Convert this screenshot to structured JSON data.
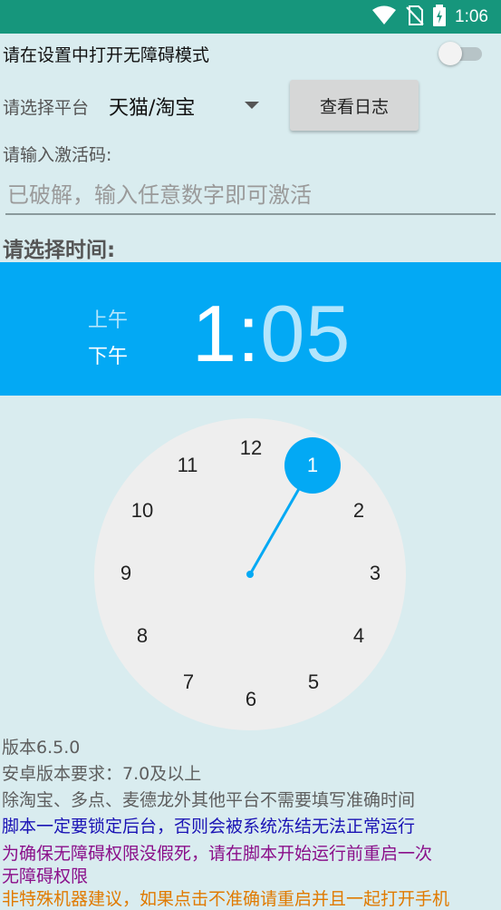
{
  "status_bar": {
    "time": "1:06"
  },
  "accessibility": {
    "label": "请在设置中打开无障碍模式",
    "enabled": false
  },
  "platform": {
    "label": "请选择平台",
    "selected": "天猫/淘宝"
  },
  "log_button": {
    "label": "查看日志"
  },
  "activation": {
    "label": "请输入激活码:",
    "placeholder": "已破解，输入任意数字即可激活"
  },
  "time_picker": {
    "title": "请选择时间:",
    "am_label": "上午",
    "pm_label": "下午",
    "hour": "1",
    "separator": ":",
    "minute": "05",
    "numbers": [
      "12",
      "1",
      "2",
      "3",
      "4",
      "5",
      "6",
      "7",
      "8",
      "9",
      "10",
      "11"
    ],
    "selected_hour": "1",
    "accent_color": "#03a9f4"
  },
  "info": {
    "version": "版本6.5.0",
    "android_req": "安卓版本要求：7.0及以上",
    "note1": "除淘宝、多点、麦德龙外其他平台不需要填写准确时间",
    "note2": "脚本一定要锁定后台，否则会被系统冻结无法正常运行",
    "note3_line1": "为确保无障碍权限没假死，请在脚本开始运行前重启一次",
    "note3_line2": "无障碍权限",
    "note4": "非特殊机器建议，如果点击不准确请重启并且一起打开手机"
  }
}
